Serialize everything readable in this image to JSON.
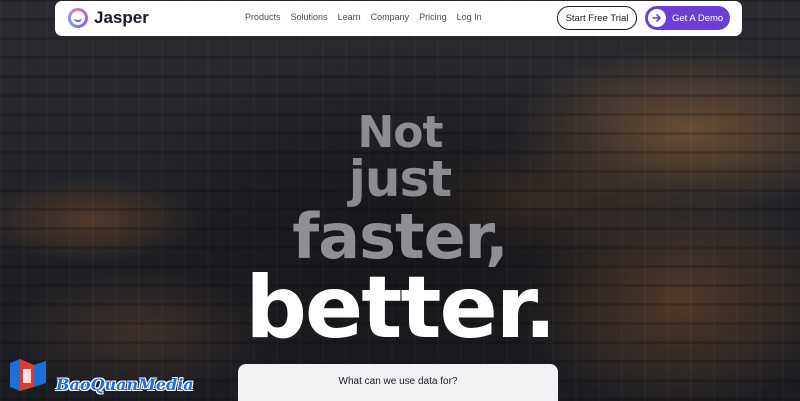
{
  "nav": {
    "logo_text": "Jasper",
    "links": [
      "Products",
      "Solutions",
      "Learn",
      "Company",
      "Pricing",
      "Log In"
    ],
    "trial_button": "Start Free Trial",
    "demo_button": "Get A Demo"
  },
  "hero": {
    "line1": "Not",
    "line2": "just",
    "line3": "faster,",
    "line4": "better."
  },
  "data_card": {
    "title": "What can we use data for?"
  },
  "watermark": {
    "text": "BaoQuanMedia"
  },
  "colors": {
    "accent": "#6b3fd6",
    "watermark": "#1e6fd8"
  }
}
